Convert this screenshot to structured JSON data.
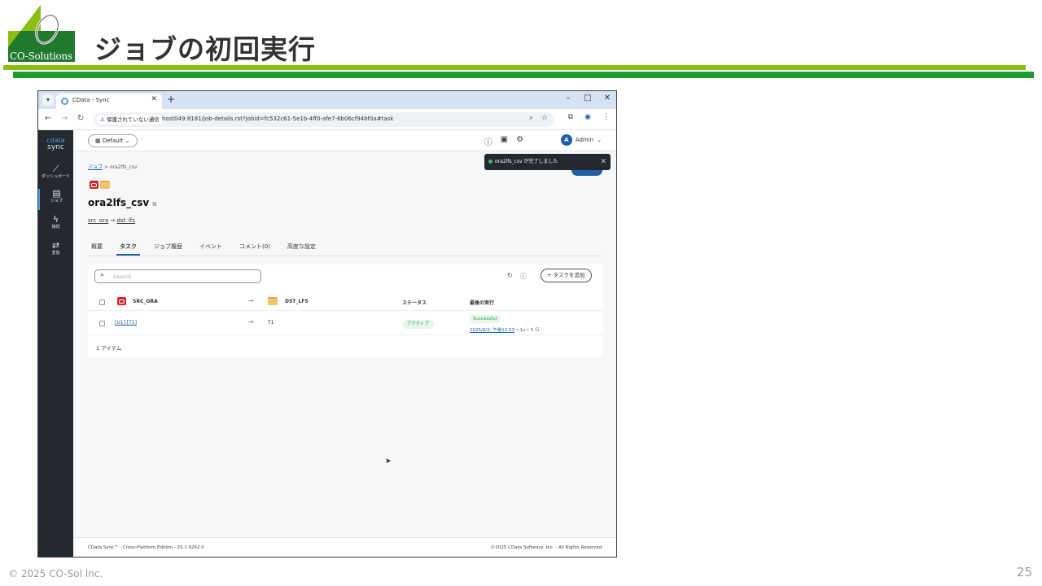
{
  "slide": {
    "title": "ジョブの初回実行",
    "logo_text": "CO-Solutions",
    "copyright": "© 2025 CO-Sol Inc.",
    "page_number": "25",
    "colors": {
      "bar_light": "#8cbf14",
      "bar_dark": "#1f9a2e"
    }
  },
  "browser": {
    "tab_title": "CData - Sync",
    "security_label": "保護されていない通信",
    "url": "host049:8181/job-details.rst?jobid=fc532c61-5e1b-4ff0-afe7-6b06cf94bf0a#task",
    "icons": {
      "back": "back-icon",
      "forward": "forward-icon",
      "reload": "reload-icon"
    }
  },
  "app": {
    "brand_top": "cdata",
    "brand_bottom": "sync",
    "sidebar": [
      {
        "label": "ダッシュボード",
        "icon": "chart-icon"
      },
      {
        "label": "ジョブ",
        "icon": "jobs-icon"
      },
      {
        "label": "接続",
        "icon": "plug-icon"
      },
      {
        "label": "変換",
        "icon": "transform-icon"
      }
    ],
    "workspace": "Default",
    "user": "Admin",
    "user_initial": "A",
    "toast": "ora2lfs_csv が完了しました",
    "breadcrumb": {
      "root": "ジョブ",
      "sep": ">",
      "current": "ora2lfs_csv"
    },
    "job_name": "ora2lfs_csv",
    "path": {
      "source": "src_ora",
      "arrow": "→",
      "dest": "dst_lfs"
    },
    "tabs": [
      "概要",
      "タスク",
      "ジョブ履歴",
      "イベント",
      "コメント(0)",
      "高度な設定"
    ],
    "active_tab": "タスク",
    "search_placeholder": "Search",
    "add_task": "タスクを追加",
    "table": {
      "headers": {
        "source": "SRC_ORA",
        "dest": "DST_LFS",
        "status": "ステータス",
        "last_run": "最後の実行"
      },
      "rows": [
        {
          "source": "[U1].[T1]",
          "dest": "T1",
          "status": "アクティブ",
          "result": "Successful",
          "run_time": "2025/6/2, 午後12:53",
          "run_meta": "• 1s • 5 行"
        }
      ]
    },
    "item_count": "1 アイテム",
    "footer_left": "CData Sync™ - Cross-Platform Edition - 25.1.9242.0",
    "footer_right": "©2025 CData Software, Inc. - All Rights Reserved."
  }
}
